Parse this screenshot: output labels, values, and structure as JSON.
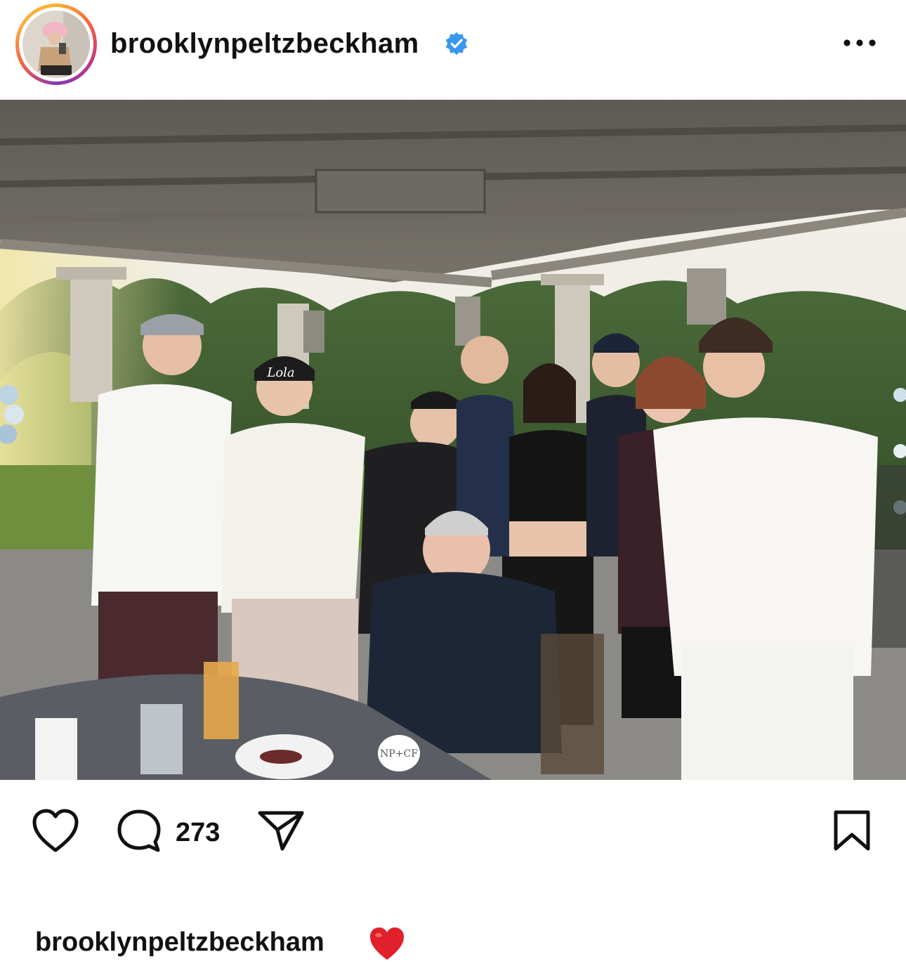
{
  "post": {
    "username": "brooklynpeltzbeckham",
    "verified": true,
    "more_icon": "more-horizontal-icon",
    "image_alt": "Group photo on an outdoor patio",
    "cake_topper_text": "NP+CF",
    "hat_text": "Lola"
  },
  "actions": {
    "like_icon": "heart-outline-icon",
    "comment_icon": "comment-icon",
    "comment_count": "273",
    "share_icon": "paper-plane-icon",
    "save_icon": "bookmark-icon"
  },
  "caption": {
    "username": "brooklynpeltzbeckham",
    "emoji": "red-heart-emoji"
  },
  "colors": {
    "verified_blue": "#3897f0",
    "heart_red": "#e0202a",
    "text": "#111111"
  }
}
